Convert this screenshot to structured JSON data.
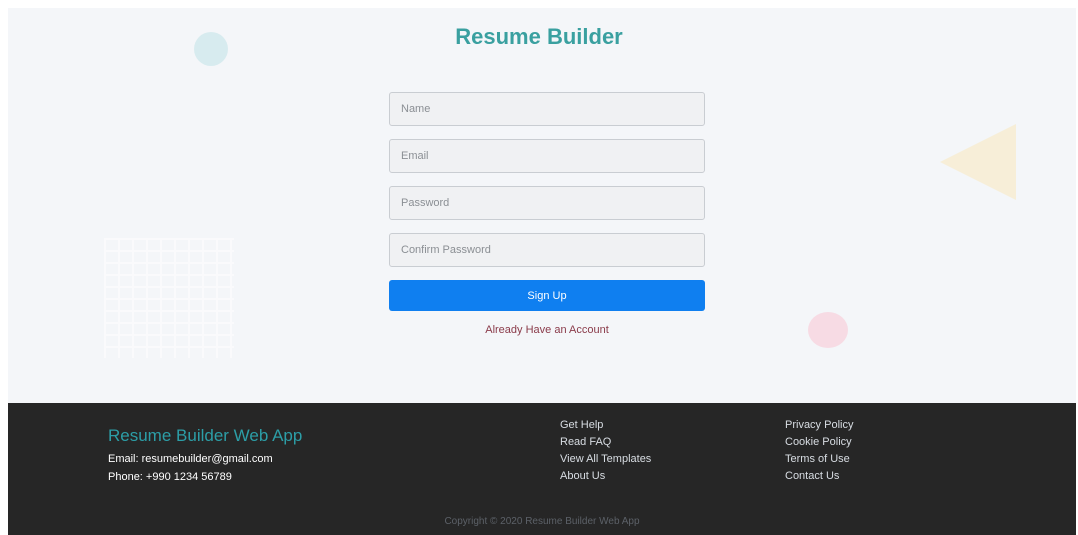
{
  "header": {
    "title": "Resume Builder"
  },
  "form": {
    "name_placeholder": "Name",
    "email_placeholder": "Email",
    "password_placeholder": "Password",
    "confirm_placeholder": "Confirm Password",
    "submit_label": "Sign Up",
    "login_link": "Already Have an Account"
  },
  "footer": {
    "brand": "Resume Builder Web App",
    "email": "Email: resumebuilder@gmail.com",
    "phone": "Phone: +990 1234 56789",
    "links_col1": [
      "Get Help",
      "Read FAQ",
      "View All Templates",
      "About Us"
    ],
    "links_col2": [
      "Privacy Policy",
      "Cookie Policy",
      "Terms of Use",
      "Contact Us"
    ],
    "copyright": "Copyright © 2020 Resume Builder Web App"
  },
  "colors": {
    "title": "#3aa0a0",
    "button": "#0f7ff0",
    "footer_bg": "#262626",
    "brand": "#2c9ea7",
    "link": "#8a3b4a"
  }
}
